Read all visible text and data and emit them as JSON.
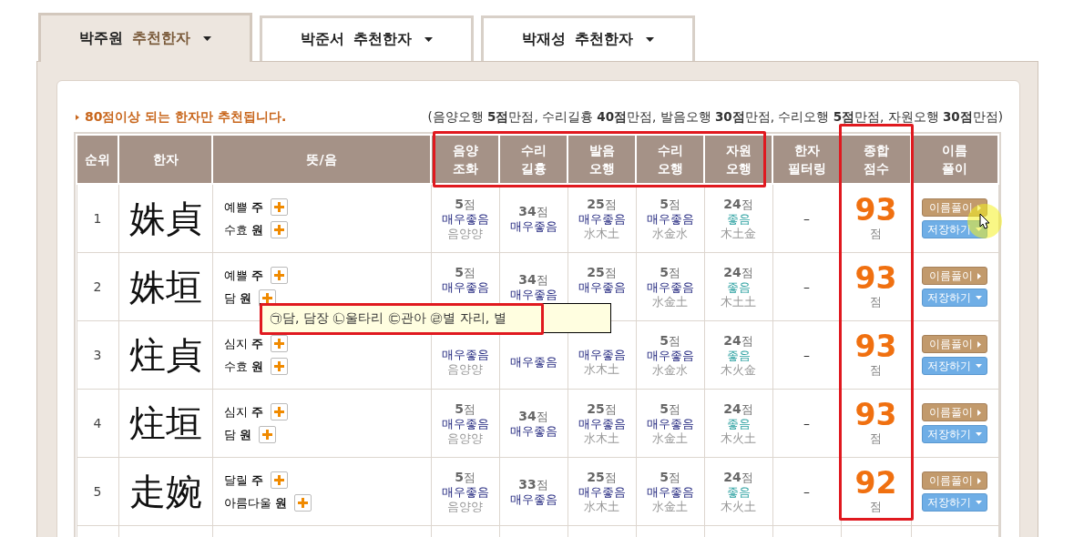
{
  "tabs": [
    {
      "name": "박주원",
      "label": "추천한자",
      "selected": true
    },
    {
      "name": "박준서",
      "label": "추천한자",
      "selected": false
    },
    {
      "name": "박재성",
      "label": "추천한자",
      "selected": false
    }
  ],
  "notice": "80점이상 되는 한자만 추천됩니다.",
  "criteria": "(음양오행 **5점**만점, 수리길흉 **40점**만점, 발음오행 **30점**만점, 수리오행 **5점**만점, 자원오행 **30점**만점)",
  "columns": [
    [
      "순위"
    ],
    [
      "한자"
    ],
    [
      "뜻/음"
    ],
    [
      "음양",
      "조화"
    ],
    [
      "수리",
      "길흉"
    ],
    [
      "발음",
      "오행"
    ],
    [
      "수리",
      "오행"
    ],
    [
      "자원",
      "오행"
    ],
    [
      "한자",
      "필터링"
    ],
    [
      "종합",
      "점수"
    ],
    [
      "이름",
      "풀이"
    ]
  ],
  "rows": [
    {
      "rank": "1",
      "hanja": "姝貞",
      "meanings": [
        {
          "meaning": "예쁠",
          "sound": "주"
        },
        {
          "meaning": "수효",
          "sound": "원"
        }
      ],
      "scores": [
        {
          "points": "5",
          "unit": "점",
          "grade": "매우좋음",
          "excellent": true,
          "detail": "음양양"
        },
        {
          "points": "34",
          "unit": "점",
          "grade": "매우좋음",
          "excellent": true
        },
        {
          "points": "25",
          "unit": "점",
          "grade": "매우좋음",
          "excellent": true,
          "detail": "水木土"
        },
        {
          "points": "5",
          "unit": "점",
          "grade": "매우좋음",
          "excellent": true,
          "detail": "水金水"
        },
        {
          "points": "24",
          "unit": "점",
          "grade": "좋음",
          "excellent": false,
          "detail": "木土金"
        }
      ],
      "filter": "–",
      "total": "93",
      "total_unit": "점",
      "buttons": [
        "이름풀이",
        "저장하기"
      ]
    },
    {
      "rank": "2",
      "hanja": "姝垣",
      "meanings": [
        {
          "meaning": "예쁠",
          "sound": "주"
        },
        {
          "meaning": "담",
          "sound": "원"
        }
      ],
      "scores": [
        {
          "points": "5",
          "unit": "점",
          "grade": "매우좋음",
          "excellent": true
        },
        {
          "points": "34",
          "unit": "점",
          "grade": "매우좋음",
          "excellent": true
        },
        {
          "points": "25",
          "unit": "점",
          "grade": "매우좋음",
          "excellent": true
        },
        {
          "points": "5",
          "unit": "점",
          "grade": "매우좋음",
          "excellent": true,
          "detail": "水金土"
        },
        {
          "points": "24",
          "unit": "점",
          "grade": "좋음",
          "excellent": false,
          "detail": "木土土"
        }
      ],
      "filter": "–",
      "total": "93",
      "total_unit": "점",
      "buttons": [
        "이름풀이",
        "저장하기"
      ]
    },
    {
      "rank": "3",
      "hanja": "炷貞",
      "meanings": [
        {
          "meaning": "심지",
          "sound": "주"
        },
        {
          "meaning": "수효",
          "sound": "원"
        }
      ],
      "scores": [
        {
          "grade": "매우좋음",
          "excellent": true,
          "detail": "음양양"
        },
        {
          "grade": "매우좋음",
          "excellent": true
        },
        {
          "grade": "매우좋음",
          "excellent": true,
          "detail": "水木土"
        },
        {
          "points": "5",
          "unit": "점",
          "grade": "매우좋음",
          "excellent": true,
          "detail": "水金水"
        },
        {
          "points": "24",
          "unit": "점",
          "grade": "좋음",
          "excellent": false,
          "detail": "木火金"
        }
      ],
      "filter": "–",
      "total": "93",
      "total_unit": "점",
      "buttons": [
        "이름풀이",
        "저장하기"
      ]
    },
    {
      "rank": "4",
      "hanja": "炷垣",
      "meanings": [
        {
          "meaning": "심지",
          "sound": "주"
        },
        {
          "meaning": "담",
          "sound": "원"
        }
      ],
      "scores": [
        {
          "points": "5",
          "unit": "점",
          "grade": "매우좋음",
          "excellent": true,
          "detail": "음양양"
        },
        {
          "points": "34",
          "unit": "점",
          "grade": "매우좋음",
          "excellent": true
        },
        {
          "points": "25",
          "unit": "점",
          "grade": "매우좋음",
          "excellent": true,
          "detail": "水木土"
        },
        {
          "points": "5",
          "unit": "점",
          "grade": "매우좋음",
          "excellent": true,
          "detail": "水金土"
        },
        {
          "points": "24",
          "unit": "점",
          "grade": "좋음",
          "excellent": false,
          "detail": "木火土"
        }
      ],
      "filter": "–",
      "total": "93",
      "total_unit": "점",
      "buttons": [
        "이름풀이",
        "저장하기"
      ]
    },
    {
      "rank": "5",
      "hanja": "走婉",
      "meanings": [
        {
          "meaning": "달릴",
          "sound": "주"
        },
        {
          "meaning": "아름다울",
          "sound": "원"
        }
      ],
      "scores": [
        {
          "points": "5",
          "unit": "점",
          "grade": "매우좋음",
          "excellent": true,
          "detail": "음양양"
        },
        {
          "points": "33",
          "unit": "점",
          "grade": "매우좋음",
          "excellent": true
        },
        {
          "points": "25",
          "unit": "점",
          "grade": "매우좋음",
          "excellent": true,
          "detail": "水木土"
        },
        {
          "points": "5",
          "unit": "점",
          "grade": "매우좋음",
          "excellent": true,
          "detail": "水金土"
        },
        {
          "points": "24",
          "unit": "점",
          "grade": "좋음",
          "excellent": false,
          "detail": "木火土"
        }
      ],
      "filter": "–",
      "total": "92",
      "total_unit": "점",
      "buttons": [
        "이름풀이",
        "저장하기"
      ]
    }
  ],
  "tooltip": "㉠담, 담장 ㉡울타리 ㉢관아 ㉣별 자리, 별"
}
